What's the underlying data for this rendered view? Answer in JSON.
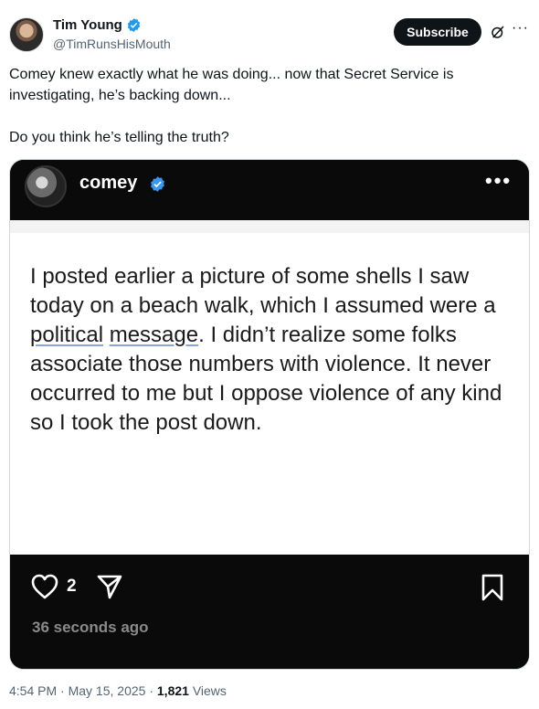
{
  "tweet": {
    "display_name": "Tim Young",
    "handle": "@TimRunsHisMouth",
    "subscribe_label": "Subscribe",
    "more_label": "···",
    "text_line1": "Comey knew exactly what he was doing... now that Secret Service is investigating, he’s backing down...",
    "text_line2": "Do you think he’s telling the truth?",
    "time": "4:54 PM",
    "date": "May 15, 2025",
    "views_count": "1,821",
    "views_label": "Views",
    "separator": "·"
  },
  "media": {
    "username": "comey",
    "more_label": "•••",
    "body_text_parts": [
      "I posted earlier a picture of some shells I saw today on a beach walk, which I assumed were a ",
      "political",
      " ",
      "message",
      ". I didn’t realize some folks associate those numbers with violence. It never occurred to me but I oppose violence of any kind so I took the post down."
    ],
    "like_count": "2",
    "time_ago": "36 seconds ago"
  },
  "colors": {
    "verified": "#1d9bf0",
    "ig_verified": "#3897f0"
  },
  "icons": [
    "verified-badge-icon",
    "grok-icon",
    "more-icon",
    "heart-icon",
    "send-icon",
    "bookmark-icon"
  ]
}
